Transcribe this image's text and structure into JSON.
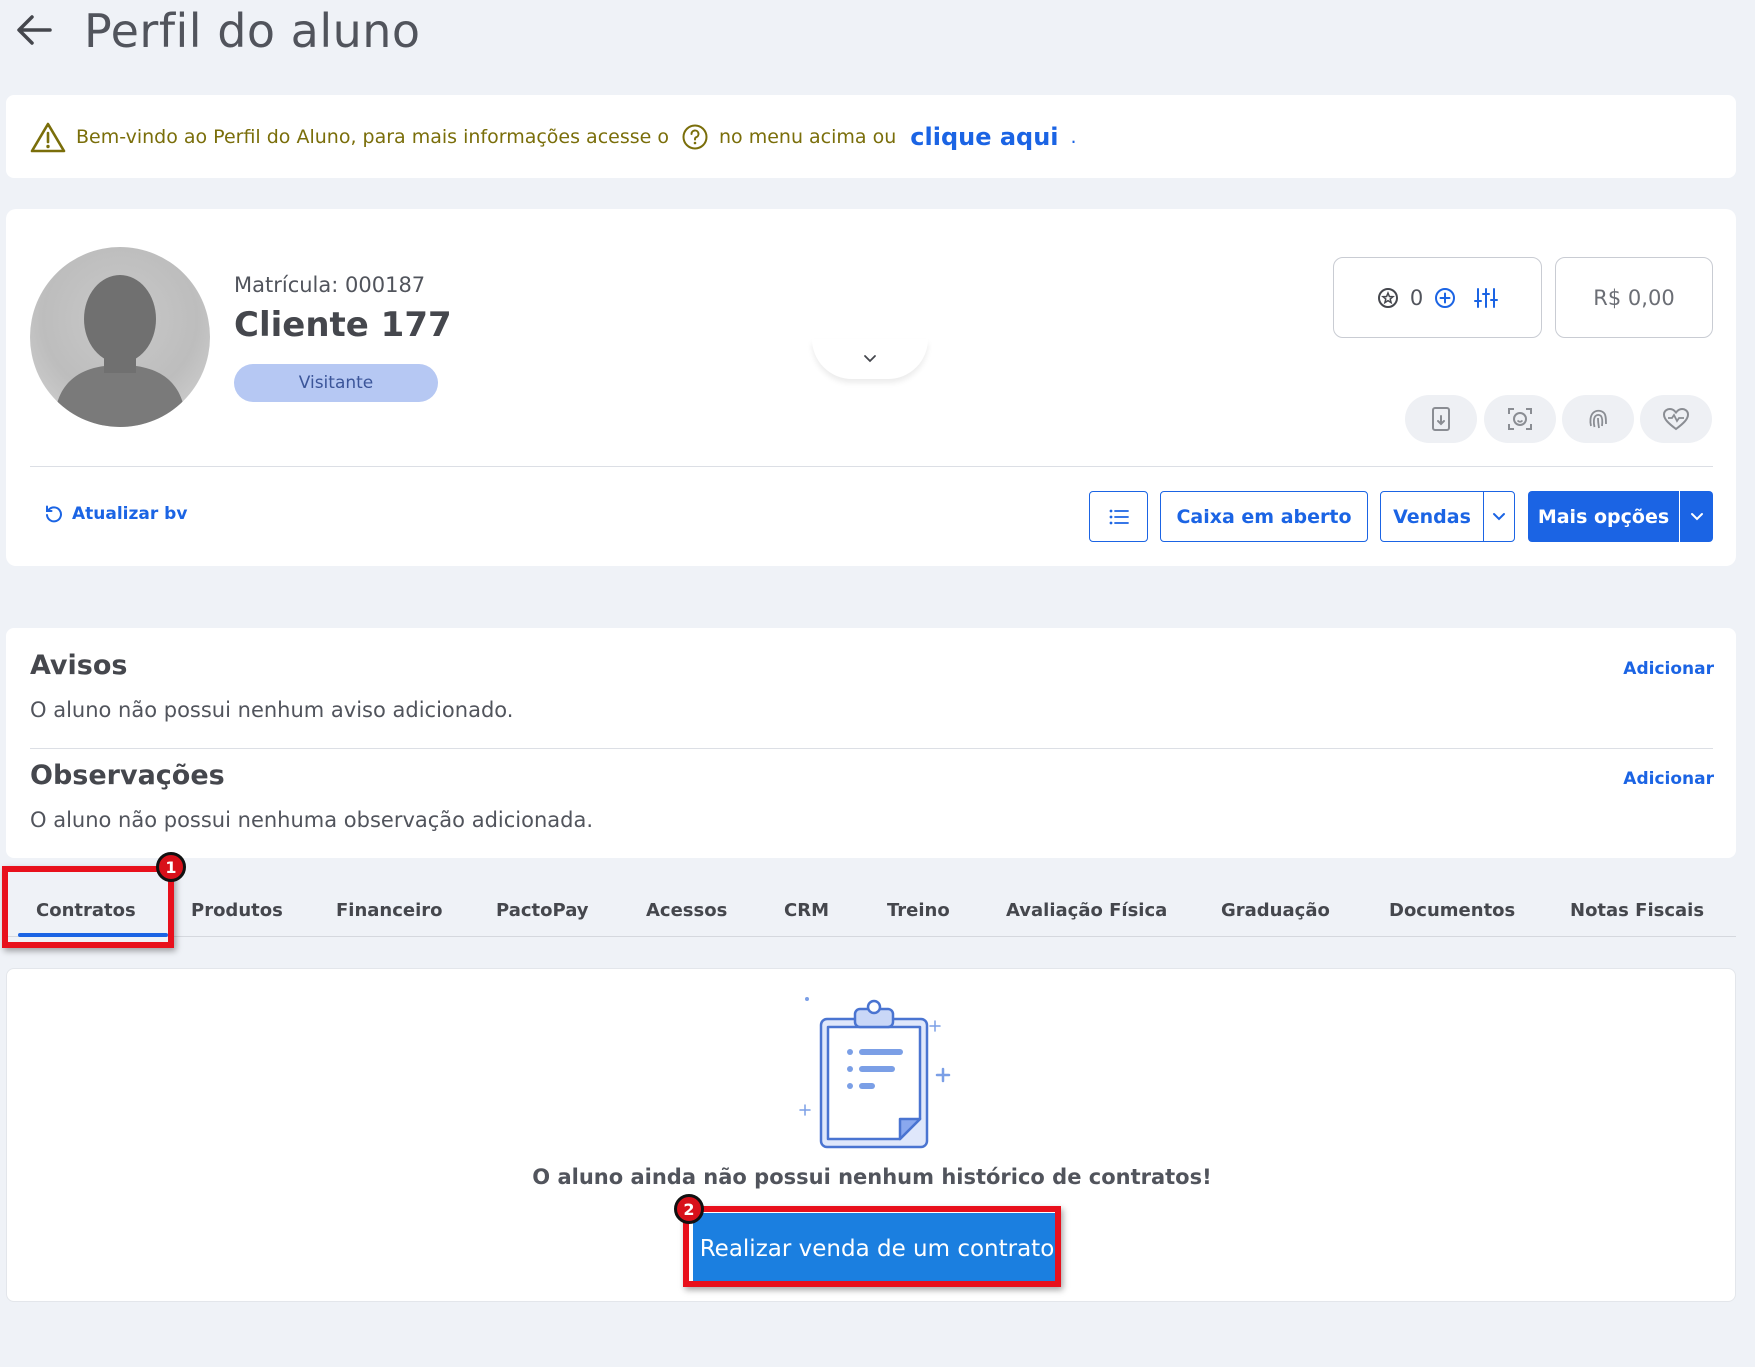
{
  "header": {
    "title": "Perfil do aluno"
  },
  "banner": {
    "text_before": "Bem-vindo ao Perfil do Aluno, para mais informações acesse o",
    "text_after": "no menu acima ou",
    "link": "clique aqui",
    "dot": "."
  },
  "profile": {
    "matricula": "Matrícula: 000187",
    "name": "Cliente 177",
    "badge": "Visitante",
    "points": "0",
    "balance": "R$ 0,00"
  },
  "actions": {
    "refresh": "Atualizar bv",
    "caixa": "Caixa em aberto",
    "vendas": "Vendas",
    "mais_opcoes": "Mais opções"
  },
  "avisos": {
    "title": "Avisos",
    "text": "O aluno não possui nenhum aviso adicionado.",
    "add": "Adicionar"
  },
  "observacoes": {
    "title": "Observações",
    "text": "O aluno não possui nenhuma observação adicionada.",
    "add": "Adicionar"
  },
  "tabs": [
    "Contratos",
    "Produtos",
    "Financeiro",
    "PactoPay",
    "Acessos",
    "CRM",
    "Treino",
    "Avaliação Física",
    "Graduação",
    "Documentos",
    "Notas Fiscais"
  ],
  "contracts": {
    "empty_message": "O aluno ainda não possui nenhum histórico de contratos!",
    "sell_button": "Realizar venda de um contrato"
  },
  "markers": [
    "1",
    "2"
  ],
  "colors": {
    "accent": "#1b64e4",
    "highlight": "#e8101c"
  }
}
